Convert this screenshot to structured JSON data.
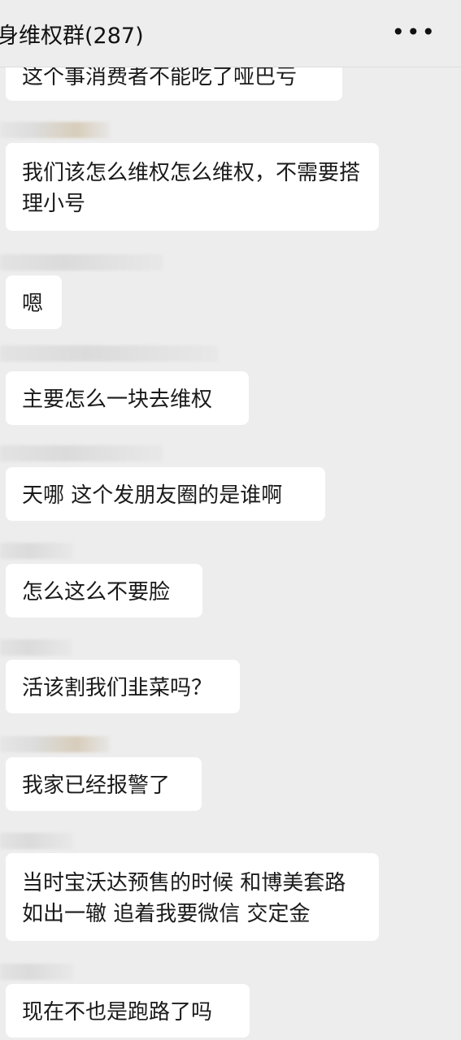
{
  "header": {
    "title": "身维权群(287)",
    "more_icon": "more-dots-icon"
  },
  "messages": [
    {
      "text": "这个事消费者不能吃了哑巴亏"
    },
    {
      "text": "我们该怎么维权怎么维权，不需要搭理小号"
    },
    {
      "text": "嗯"
    },
    {
      "text": "主要怎么一块去维权"
    },
    {
      "text": "天哪 这个发朋友圈的是谁啊"
    },
    {
      "text": "怎么这么不要脸"
    },
    {
      "text": "活该割我们韭菜吗？"
    },
    {
      "text": "我家已经报警了"
    },
    {
      "text": "当时宝沃达预售的时候 和博美套路如出一辙 追着我要微信 交定金"
    },
    {
      "text": "现在不也是跑路了吗"
    }
  ]
}
